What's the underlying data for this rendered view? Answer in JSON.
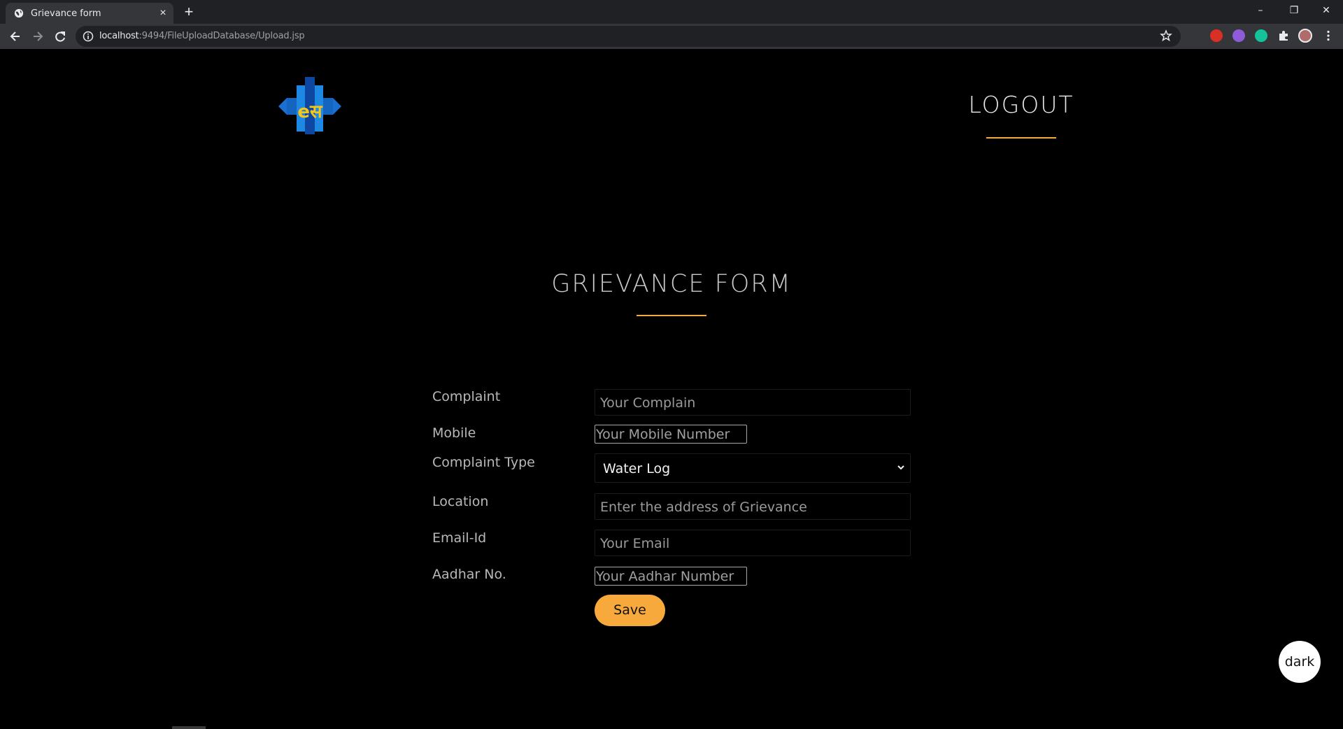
{
  "browser": {
    "tab_title": "Grievance form",
    "tab_close": "×",
    "new_tab": "+",
    "url_host": "localhost",
    "url_rest": ":9494/FileUploadDatabase/Upload.jsp",
    "window_minimize": "–",
    "window_restore": "❐",
    "window_close": "✕"
  },
  "header": {
    "logo_text": "eस",
    "logout_label": "LOGOUT"
  },
  "form": {
    "title": "GRIEVANCE FORM",
    "fields": {
      "complaint": {
        "label": "Complaint",
        "placeholder": "Your Complain"
      },
      "mobile": {
        "label": "Mobile",
        "placeholder": "Your Mobile Number"
      },
      "complaint_type": {
        "label": "Complaint Type",
        "selected": "Water Log"
      },
      "location": {
        "label": "Location",
        "placeholder": "Enter the address of Grievance"
      },
      "email": {
        "label": "Email-Id",
        "placeholder": "Your Email"
      },
      "aadhar": {
        "label": "Aadhar No.",
        "placeholder": "Your Aadhar Number"
      }
    },
    "save_label": "Save"
  },
  "dark_toggle_label": "dark",
  "colors": {
    "accent": "#f7a93b",
    "page_bg": "#000000",
    "logo_blue": "#1565c0",
    "logo_yellow": "#f5c518"
  }
}
